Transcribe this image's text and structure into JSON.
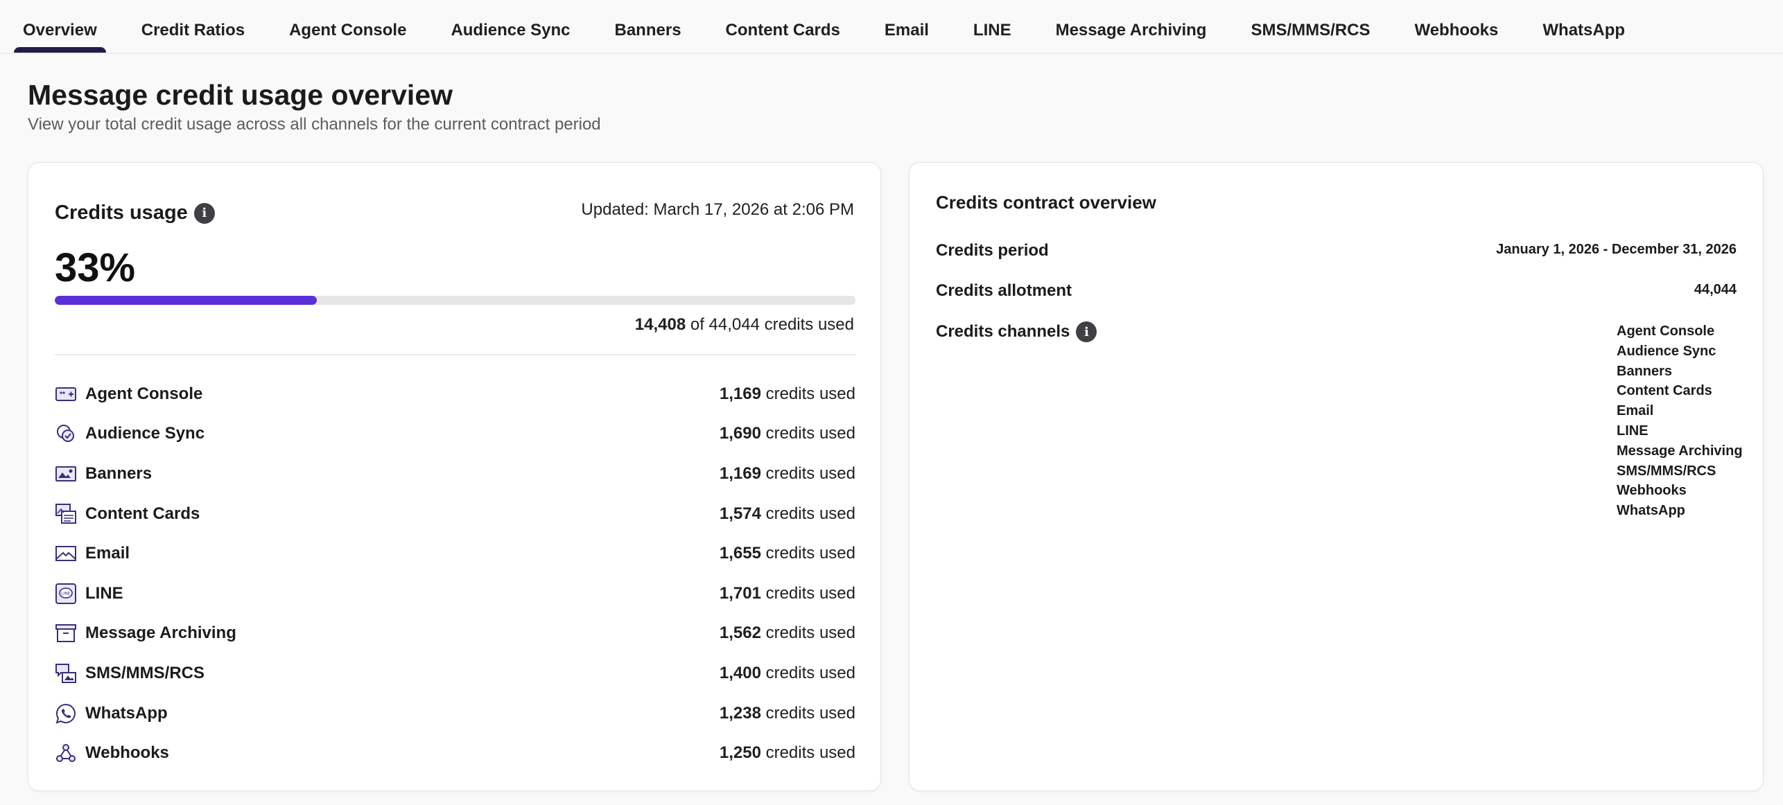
{
  "tabs": [
    {
      "label": "Overview",
      "active": true
    },
    {
      "label": "Credit Ratios"
    },
    {
      "label": "Agent Console"
    },
    {
      "label": "Audience Sync"
    },
    {
      "label": "Banners"
    },
    {
      "label": "Content Cards"
    },
    {
      "label": "Email"
    },
    {
      "label": "LINE"
    },
    {
      "label": "Message Archiving"
    },
    {
      "label": "SMS/MMS/RCS"
    },
    {
      "label": "Webhooks"
    },
    {
      "label": "WhatsApp"
    }
  ],
  "header": {
    "title": "Message credit usage overview",
    "subtitle": "View your total credit usage across all channels for the current contract period"
  },
  "usage": {
    "title": "Credits usage",
    "updated": "Updated: March 17, 2026 at 2:06 PM",
    "percent_label": "33%",
    "progress_fraction": 0.327,
    "used": "14,408",
    "total_suffix": "of 44,044 credits used",
    "credits_used_suffix": "credits used",
    "channels": [
      {
        "name": "Agent Console",
        "used": "1,169",
        "icon": "agent-console-icon"
      },
      {
        "name": "Audience Sync",
        "used": "1,690",
        "icon": "audience-sync-icon"
      },
      {
        "name": "Banners",
        "used": "1,169",
        "icon": "banners-icon"
      },
      {
        "name": "Content Cards",
        "used": "1,574",
        "icon": "content-cards-icon"
      },
      {
        "name": "Email",
        "used": "1,655",
        "icon": "email-icon"
      },
      {
        "name": "LINE",
        "used": "1,701",
        "icon": "line-icon"
      },
      {
        "name": "Message Archiving",
        "used": "1,562",
        "icon": "message-archiving-icon"
      },
      {
        "name": "SMS/MMS/RCS",
        "used": "1,400",
        "icon": "sms-icon"
      },
      {
        "name": "WhatsApp",
        "used": "1,238",
        "icon": "whatsapp-icon"
      },
      {
        "name": "Webhooks",
        "used": "1,250",
        "icon": "webhooks-icon"
      }
    ]
  },
  "contract": {
    "title": "Credits contract overview",
    "period_label": "Credits period",
    "period_value": "January 1, 2026 - December 31, 2026",
    "allotment_label": "Credits allotment",
    "allotment_value": "44,044",
    "channels_label": "Credits channels",
    "channels": [
      "Agent Console",
      "Audience Sync",
      "Banners",
      "Content Cards",
      "Email",
      "LINE",
      "Message Archiving",
      "SMS/MMS/RCS",
      "Webhooks",
      "WhatsApp"
    ]
  },
  "colors": {
    "accent": "#5b2fd8",
    "tab_indicator": "#261b46",
    "icon_stroke": "#3b2f7a"
  }
}
